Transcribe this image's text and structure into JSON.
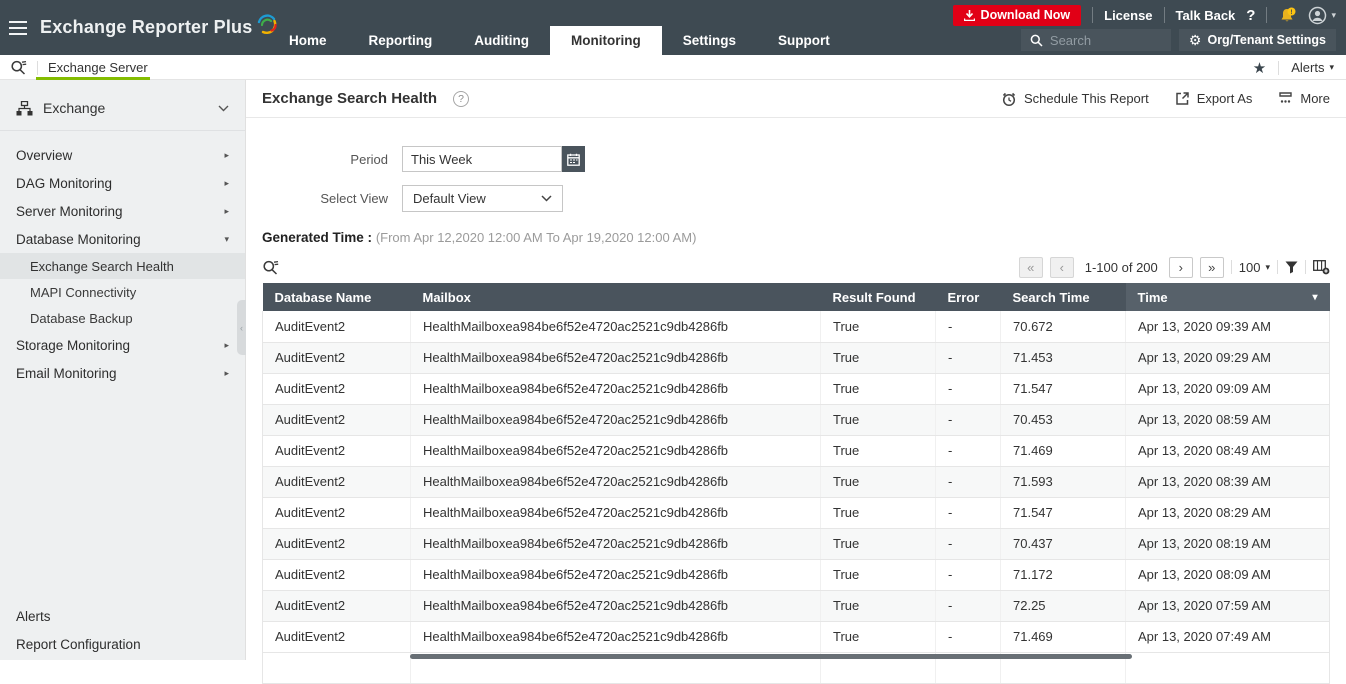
{
  "brand": {
    "name": "Exchange Reporter Plus"
  },
  "topnav": {
    "items": [
      "Home",
      "Reporting",
      "Auditing",
      "Monitoring",
      "Settings",
      "Support"
    ],
    "active": "Monitoring"
  },
  "top_actions": {
    "download": "Download Now",
    "license": "License",
    "talk_back": "Talk Back",
    "help": "?",
    "search_placeholder": "Search",
    "org_settings": "Org/Tenant Settings"
  },
  "crumbbar": {
    "tab": "Exchange Server",
    "alerts": "Alerts"
  },
  "sidebar": {
    "group": "Exchange",
    "items": [
      "Overview",
      "DAG Monitoring",
      "Server Monitoring",
      "Database Monitoring"
    ],
    "subitems": [
      "Exchange Search Health",
      "MAPI Connectivity",
      "Database Backup"
    ],
    "selected_subitem": "Exchange Search Health",
    "items2": [
      "Storage Monitoring",
      "Email Monitoring"
    ],
    "footer": [
      "Alerts",
      "Report Configuration"
    ]
  },
  "report": {
    "title": "Exchange Search Health",
    "help": "?",
    "actions": {
      "schedule": "Schedule This Report",
      "export": "Export As",
      "more": "More"
    },
    "period_label": "Period",
    "period_value": "This Week",
    "view_label": "Select View",
    "view_value": "Default View",
    "generated_label": "Generated Time :",
    "generated_value": "(From Apr 12,2020 12:00 AM To Apr 19,2020 12:00 AM)"
  },
  "pagination": {
    "first": "«",
    "prev": "‹",
    "range": "1-100 of 200",
    "next": "›",
    "last": "»",
    "page_size": "100",
    "size_caret": "▾"
  },
  "glyphs": {
    "caret_down": "▾",
    "arrow_right": "▸",
    "star": "★",
    "gear": "⚙",
    "collapse": "‹"
  },
  "colors": {
    "header_bg": "#3e4a52",
    "accent_green": "#84bd00",
    "danger_red": "#e10016",
    "table_header_bg": "#4a545d",
    "table_header_sorted": "#57616a",
    "sidebar_bg": "#eef0f1"
  },
  "table": {
    "columns": [
      "Database Name",
      "Mailbox",
      "Result Found",
      "Error",
      "Search Time",
      "Time"
    ],
    "sorted_column": "Time",
    "rows": [
      [
        "AuditEvent2",
        "HealthMailboxea984be6f52e4720ac2521c9db4286fb",
        "True",
        "-",
        "70.672",
        "Apr 13, 2020 09:39 AM"
      ],
      [
        "AuditEvent2",
        "HealthMailboxea984be6f52e4720ac2521c9db4286fb",
        "True",
        "-",
        "71.453",
        "Apr 13, 2020 09:29 AM"
      ],
      [
        "AuditEvent2",
        "HealthMailboxea984be6f52e4720ac2521c9db4286fb",
        "True",
        "-",
        "71.547",
        "Apr 13, 2020 09:09 AM"
      ],
      [
        "AuditEvent2",
        "HealthMailboxea984be6f52e4720ac2521c9db4286fb",
        "True",
        "-",
        "70.453",
        "Apr 13, 2020 08:59 AM"
      ],
      [
        "AuditEvent2",
        "HealthMailboxea984be6f52e4720ac2521c9db4286fb",
        "True",
        "-",
        "71.469",
        "Apr 13, 2020 08:49 AM"
      ],
      [
        "AuditEvent2",
        "HealthMailboxea984be6f52e4720ac2521c9db4286fb",
        "True",
        "-",
        "71.593",
        "Apr 13, 2020 08:39 AM"
      ],
      [
        "AuditEvent2",
        "HealthMailboxea984be6f52e4720ac2521c9db4286fb",
        "True",
        "-",
        "71.547",
        "Apr 13, 2020 08:29 AM"
      ],
      [
        "AuditEvent2",
        "HealthMailboxea984be6f52e4720ac2521c9db4286fb",
        "True",
        "-",
        "70.437",
        "Apr 13, 2020 08:19 AM"
      ],
      [
        "AuditEvent2",
        "HealthMailboxea984be6f52e4720ac2521c9db4286fb",
        "True",
        "-",
        "71.172",
        "Apr 13, 2020 08:09 AM"
      ],
      [
        "AuditEvent2",
        "HealthMailboxea984be6f52e4720ac2521c9db4286fb",
        "True",
        "-",
        "72.25",
        "Apr 13, 2020 07:59 AM"
      ],
      [
        "AuditEvent2",
        "HealthMailboxea984be6f52e4720ac2521c9db4286fb",
        "True",
        "-",
        "71.469",
        "Apr 13, 2020 07:49 AM"
      ]
    ]
  }
}
